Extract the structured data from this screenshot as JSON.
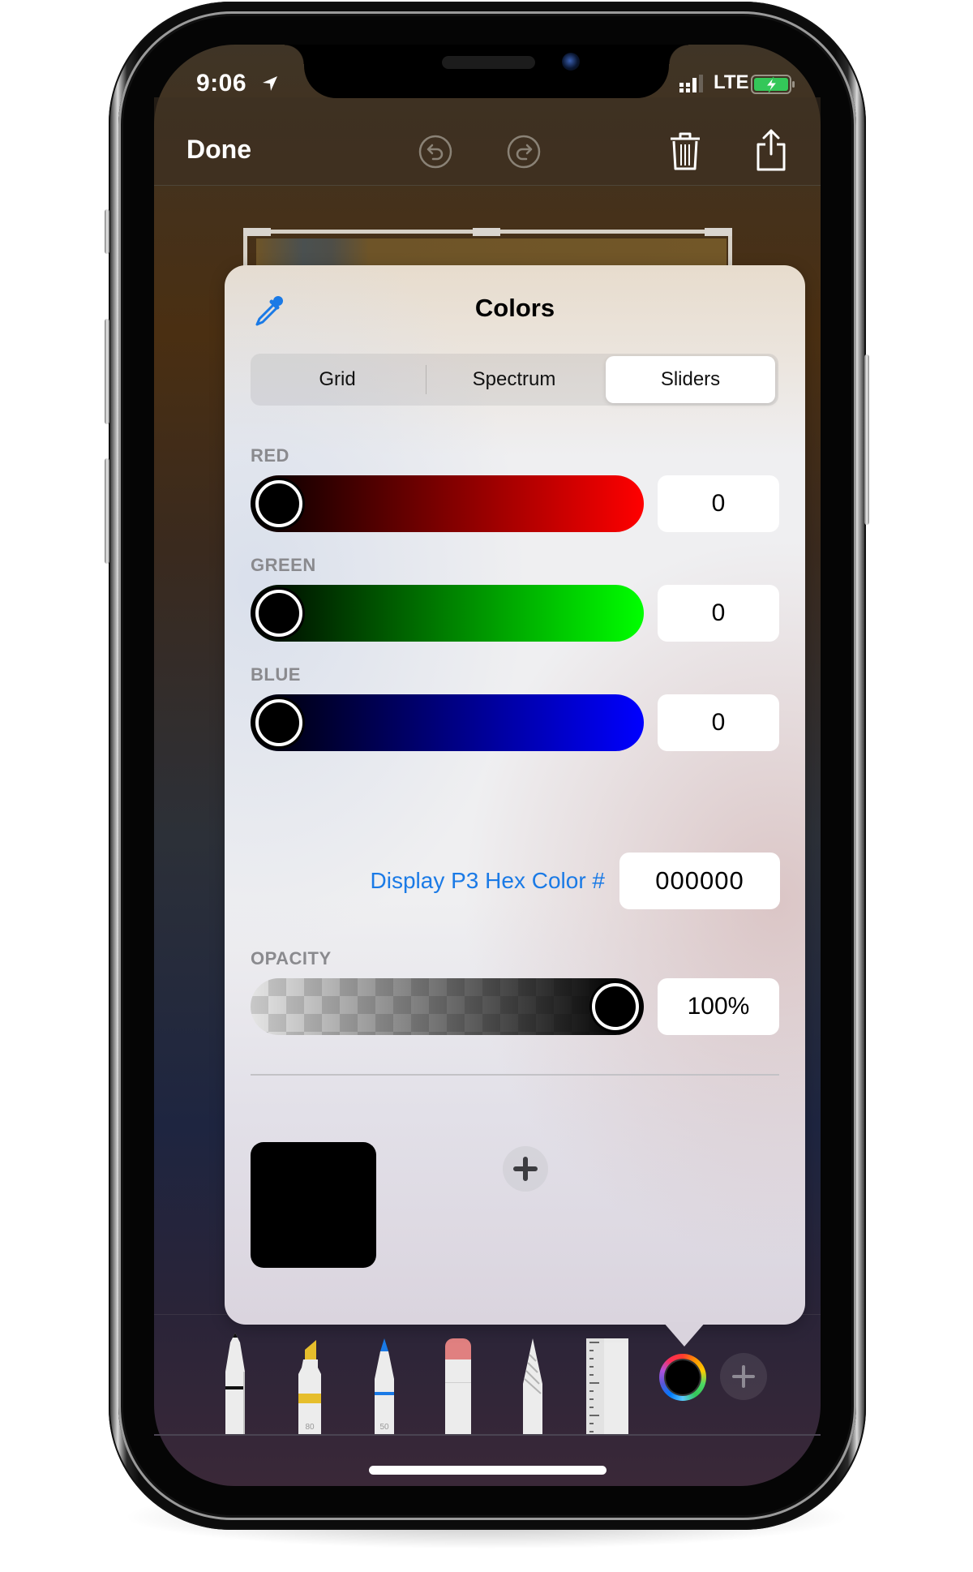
{
  "status_bar": {
    "time": "9:06",
    "location_icon": "location-arrow-icon",
    "network": "LTE",
    "signal_icon": "cellular-signal-icon",
    "battery_icon": "battery-charging-icon",
    "battery_color": "#34c759"
  },
  "toolbar": {
    "done_label": "Done",
    "undo_icon": "undo-icon",
    "redo_icon": "redo-icon",
    "delete_icon": "trash-icon",
    "share_icon": "share-icon"
  },
  "color_picker": {
    "title": "Colors",
    "eyedropper_icon": "eyedropper-icon",
    "tabs": [
      {
        "label": "Grid",
        "selected": false
      },
      {
        "label": "Spectrum",
        "selected": false
      },
      {
        "label": "Sliders",
        "selected": true
      }
    ],
    "sliders": [
      {
        "label": "RED",
        "value": "0",
        "fraction": 0,
        "end_color": "#ff0000"
      },
      {
        "label": "GREEN",
        "value": "0",
        "fraction": 0,
        "end_color": "#00ff00"
      },
      {
        "label": "BLUE",
        "value": "0",
        "fraction": 0,
        "end_color": "#0000ff"
      }
    ],
    "hex_label": "Display P3 Hex Color #",
    "hex_value": "000000",
    "opacity": {
      "label": "OPACITY",
      "value": "100%",
      "fraction": 1.0
    },
    "saved_swatches": [
      {
        "color": "#000000"
      }
    ],
    "add_swatch_icon": "plus-icon",
    "accent_color": "#1a7ae6"
  },
  "tool_tray": {
    "tools": [
      {
        "name": "pen",
        "icon": "pen-icon"
      },
      {
        "name": "marker",
        "icon": "marker-icon",
        "label": "80",
        "color": "#e6be2c"
      },
      {
        "name": "pencil",
        "icon": "pencil-icon",
        "label": "50",
        "color": "#1a7ae6"
      },
      {
        "name": "eraser",
        "icon": "eraser-icon",
        "color": "#e08080"
      },
      {
        "name": "lasso",
        "icon": "lasso-icon"
      },
      {
        "name": "ruler",
        "icon": "ruler-icon"
      }
    ],
    "current_color": "#000000",
    "color_wheel_icon": "color-wheel-icon",
    "add_icon": "plus-icon"
  }
}
